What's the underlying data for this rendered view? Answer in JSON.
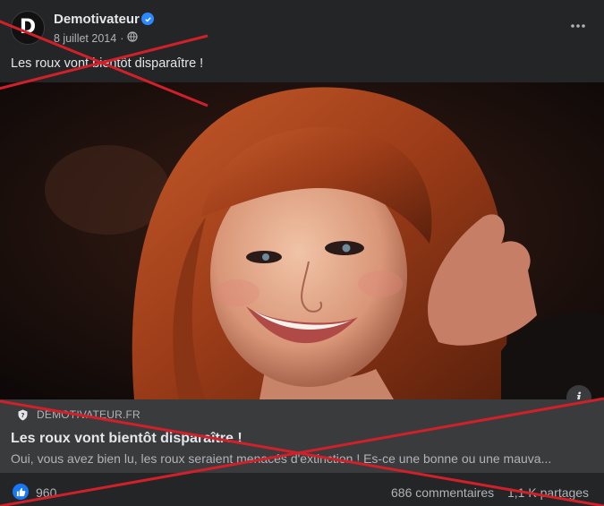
{
  "post": {
    "page_name": "Demotivateur",
    "avatar_letter": "D",
    "date": "8 juillet 2014",
    "separator": "·",
    "more_icon": "more-horizontal-icon",
    "caption": "Les roux vont bientôt disparaître !"
  },
  "link_preview": {
    "domain": "DEMOTIVATEUR.FR",
    "title": "Les roux vont bientôt disparaître !",
    "description": "Oui, vous avez bien lu, les roux seraient menacés d'extinction ! Es-ce une bonne ou une mauva..."
  },
  "engagement": {
    "reactions_count": "960",
    "comments": "686 commentaires",
    "shares": "1,1 K partages"
  },
  "colors": {
    "background": "#242526",
    "link_preview_bg": "#3a3b3c",
    "accent_blue": "#1877f2",
    "strike_red": "#d0202a"
  }
}
